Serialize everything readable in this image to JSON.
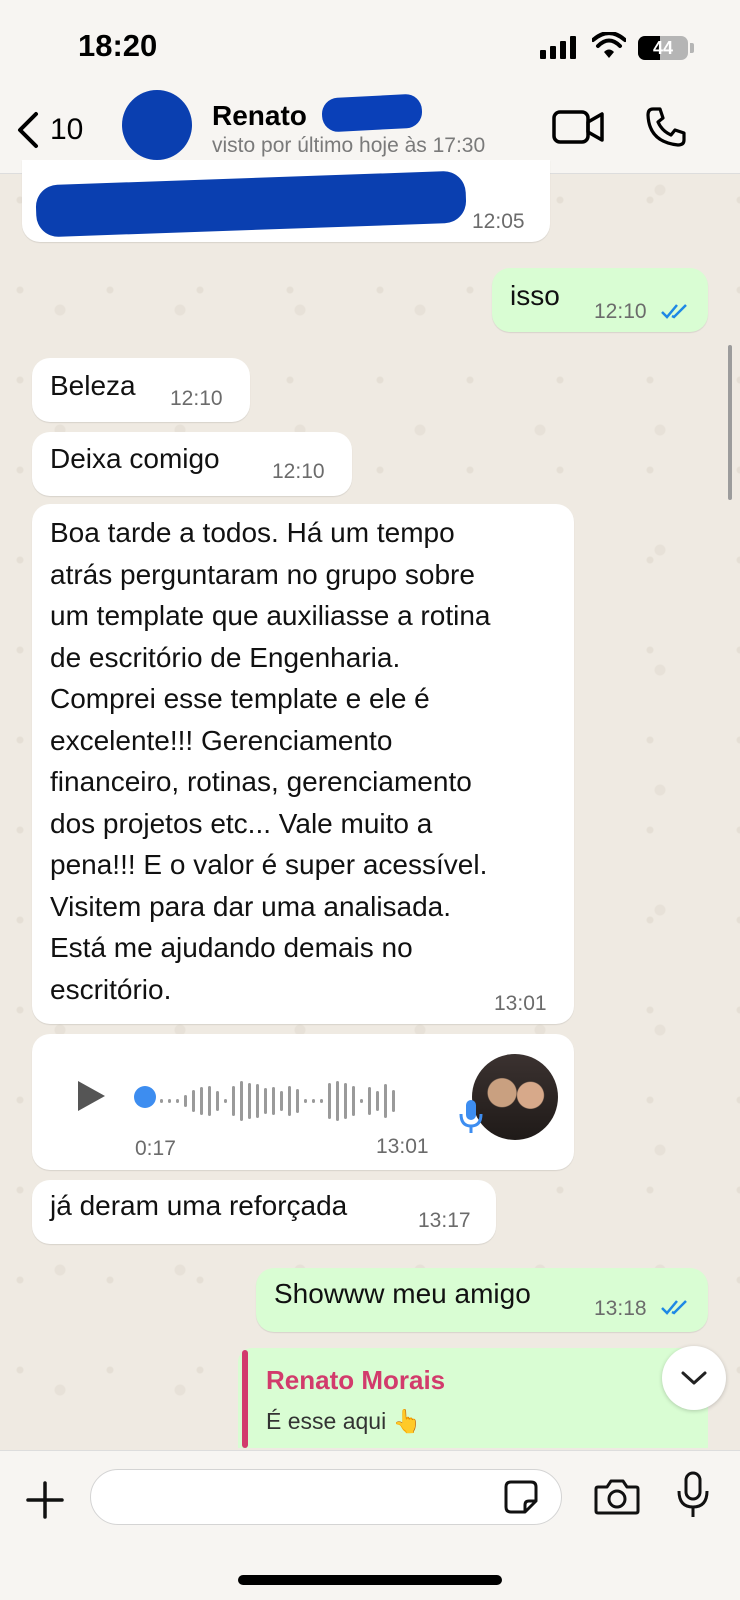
{
  "status_bar": {
    "time": "18:20",
    "battery": "44",
    "battery_level": 0.44
  },
  "header": {
    "back_count": "10",
    "contact_name": "Renato",
    "last_seen": "visto por último hoje às 17:30"
  },
  "messages": [
    {
      "type": "incoming",
      "text": "",
      "time": "12:05"
    },
    {
      "type": "outgoing",
      "text": "isso",
      "time": "12:10"
    },
    {
      "type": "incoming",
      "text": "Beleza",
      "time": "12:10"
    },
    {
      "type": "incoming",
      "text": "Deixa comigo",
      "time": "12:10"
    },
    {
      "type": "incoming",
      "lines": [
        "Boa tarde a todos. Há um tempo",
        "atrás perguntaram no grupo sobre",
        "um template que auxiliasse a rotina",
        "de escritório de Engenharia.",
        "Comprei esse template e ele é",
        "excelente!!! Gerenciamento",
        "financeiro, rotinas, gerenciamento",
        "dos projetos etc... Vale muito a",
        "pena!!! E o valor é super acessível.",
        "Visitem para dar uma analisada.",
        "Está me ajudando demais no",
        "escritório."
      ],
      "time": "13:01"
    },
    {
      "type": "voice",
      "duration": "0:17",
      "time": "13:01"
    },
    {
      "type": "incoming",
      "text": "já deram uma reforçada",
      "time": "13:17"
    },
    {
      "type": "outgoing",
      "text": "Showww meu amigo",
      "time": "13:18"
    }
  ],
  "reply": {
    "name": "Renato Morais",
    "text": "É esse aqui 👆"
  },
  "composer": {
    "placeholder": ""
  },
  "colors": {
    "background": "#efeae2",
    "outgoing_bubble": "#d9fdd3",
    "incoming_bubble": "#ffffff",
    "read_ticks": "#1e88e5",
    "reply_accent": "#d23b6c",
    "redaction": "#0a3fb0"
  },
  "icons": [
    "back-chevron-icon",
    "video-call-icon",
    "phone-icon",
    "double-check-icon",
    "play-icon",
    "mic-icon",
    "chevron-down-icon",
    "plus-icon",
    "sticker-icon",
    "camera-icon"
  ]
}
